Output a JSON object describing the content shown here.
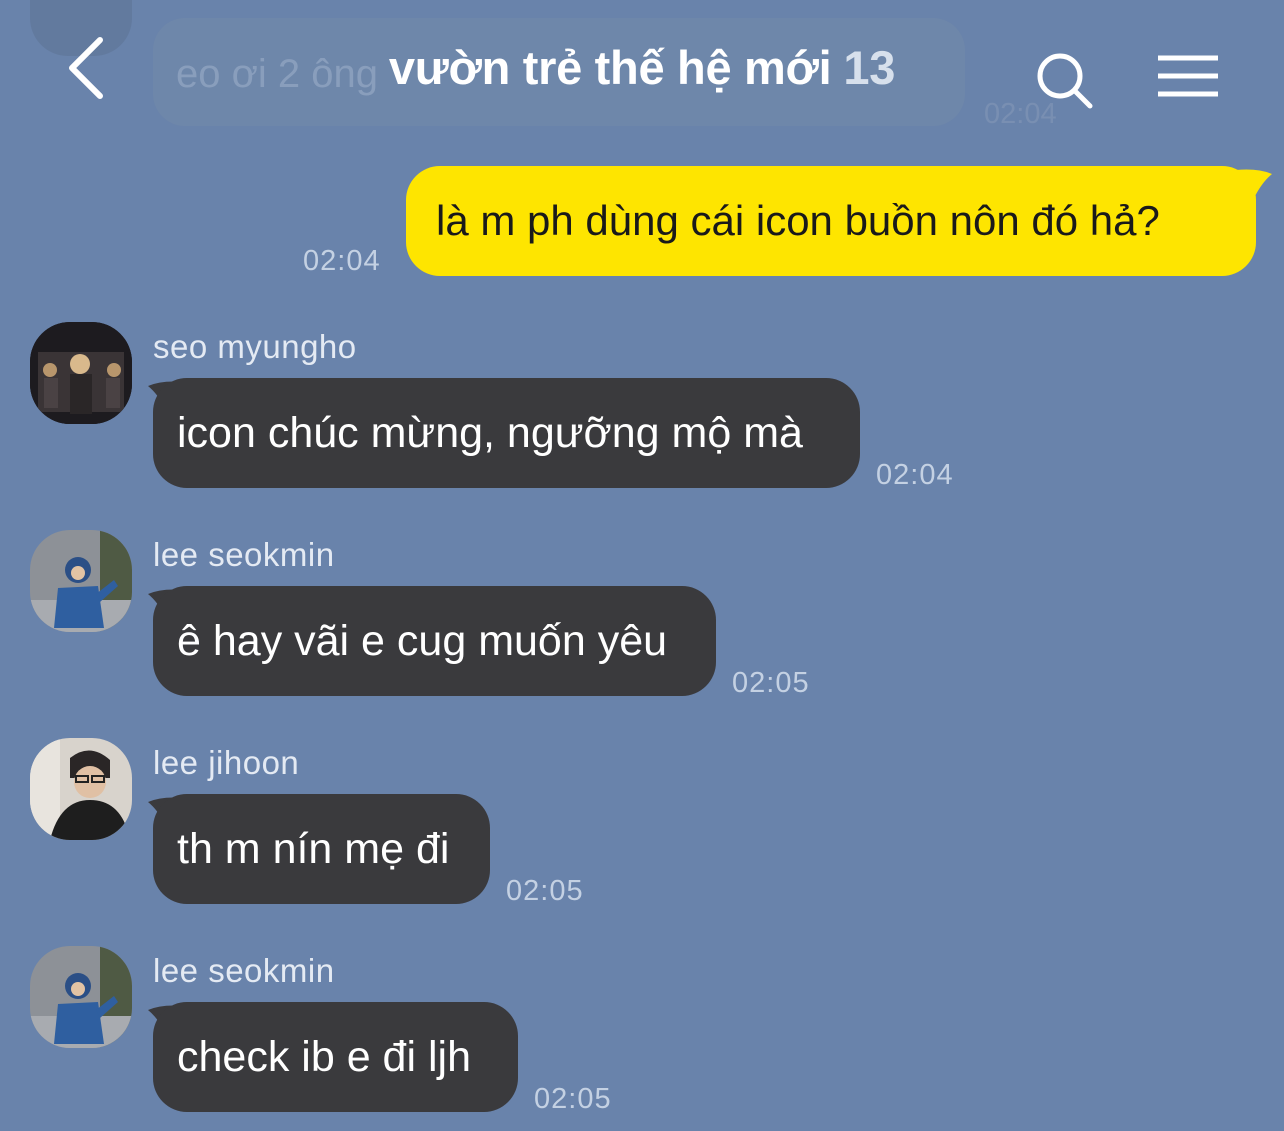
{
  "header": {
    "title": "vườn trẻ thế hệ mới",
    "member_count": "13",
    "back_icon": "chevron-left-icon",
    "search_icon": "search-icon",
    "menu_icon": "hamburger-menu-icon"
  },
  "previous_message": {
    "text": "eo ơi 2 ông",
    "time": "02:04"
  },
  "my_message": {
    "text": "là m ph dùng cái icon buồn nôn đó hả?",
    "time": "02:04"
  },
  "messages": [
    {
      "sender": "seo myungho",
      "text": "icon chúc mừng, ngưỡng mộ mà",
      "time": "02:04"
    },
    {
      "sender": "lee seokmin",
      "text": "ê hay vãi e cug muốn yêu",
      "time": "02:05"
    },
    {
      "sender": "lee jihoon",
      "text": "th m nín mẹ đi",
      "time": "02:05"
    },
    {
      "sender": "lee seokmin",
      "text": "check ib e đi ljh",
      "time": "02:05"
    }
  ],
  "colors": {
    "background": "#6983ab",
    "my_bubble": "#fee500",
    "other_bubble": "#3a3a3d"
  }
}
